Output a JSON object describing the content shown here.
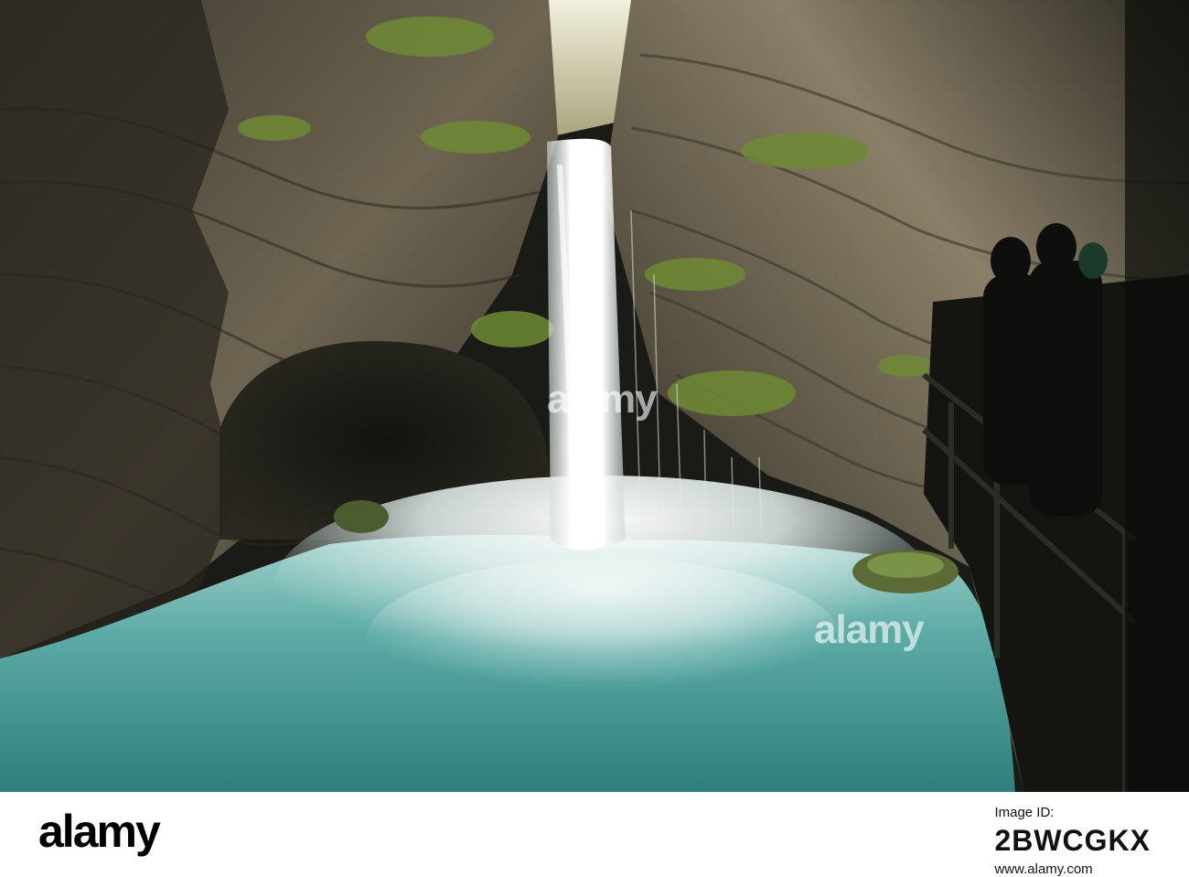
{
  "photo": {
    "subject": "waterfall-in-canyon",
    "colors": {
      "water": "#4a9e9b",
      "foam": "#e9f1f0",
      "rock": "#5a5346",
      "moss": "#6f8a34",
      "shadow": "#0f100d"
    }
  },
  "watermark": {
    "text": "alamy"
  },
  "footer": {
    "brand": "alamy",
    "id_label": "Image ID:",
    "image_id": "2BWCGKX",
    "url": "www.alamy.com"
  }
}
